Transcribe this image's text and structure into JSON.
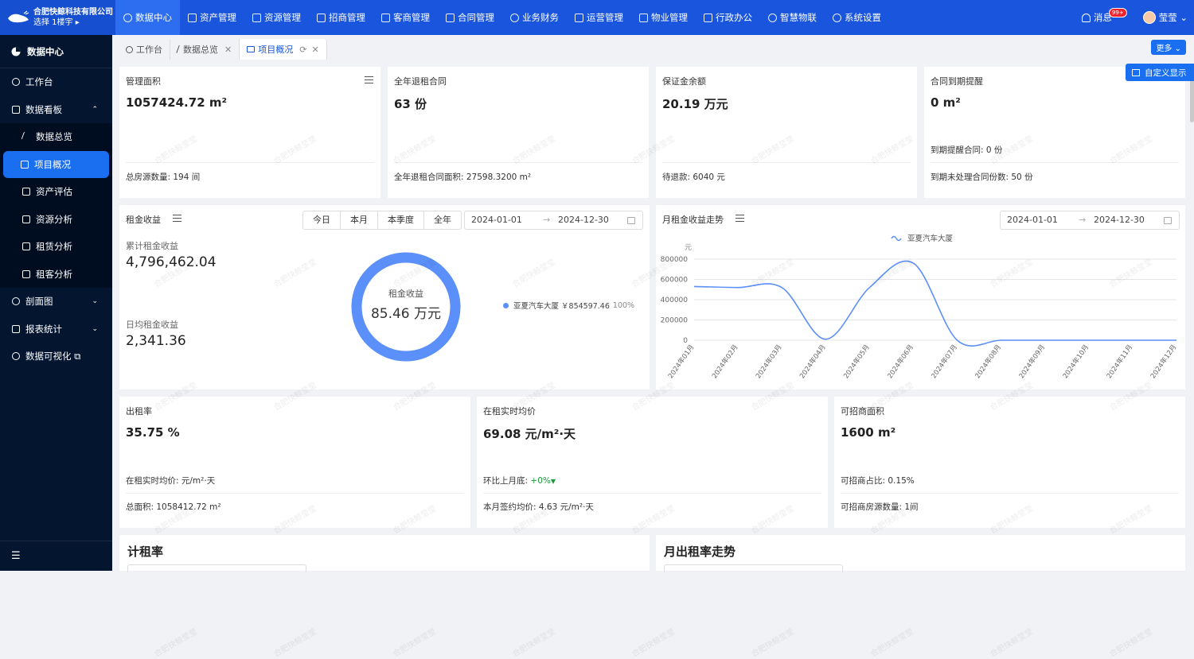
{
  "header": {
    "company": "合肥快鲸科技有限公司",
    "building_select": "选择 1楼宇 ▸",
    "nav": [
      {
        "label": "数据中心",
        "active": true
      },
      {
        "label": "资产管理"
      },
      {
        "label": "资源管理"
      },
      {
        "label": "招商管理"
      },
      {
        "label": "客商管理"
      },
      {
        "label": "合同管理"
      },
      {
        "label": "业务财务"
      },
      {
        "label": "运营管理"
      },
      {
        "label": "物业管理"
      },
      {
        "label": "行政办公"
      },
      {
        "label": "智慧物联"
      },
      {
        "label": "系统设置"
      }
    ],
    "message_label": "消息",
    "message_badge": "99+",
    "user": "莹莹 ⌄"
  },
  "sidebar": {
    "title": "数据中心",
    "items": [
      {
        "label": "工作台"
      },
      {
        "label": "数据看板",
        "arrow": "⌃"
      },
      {
        "label": "数据总览"
      },
      {
        "label": "项目概况"
      },
      {
        "label": "资产评估"
      },
      {
        "label": "资源分析"
      },
      {
        "label": "租赁分析"
      },
      {
        "label": "租客分析"
      },
      {
        "label": "剖面图",
        "arrow": "⌄"
      },
      {
        "label": "报表统计",
        "arrow": "⌄"
      },
      {
        "label": "数据可视化 ⧉"
      }
    ],
    "collapse": "☰"
  },
  "tabs": [
    {
      "label": "工作台"
    },
    {
      "label": "数据总览",
      "close": "✕"
    },
    {
      "label": "项目概况",
      "close": "✕"
    }
  ],
  "more_button": "更多 ⌄",
  "custom_button": "自定义显示",
  "watermark": "合肥快鲸莹莹",
  "cards_row1": [
    {
      "title": "管理面积",
      "value": "1057424.72 m²",
      "lines": [
        "总房源数量: 194 间"
      ]
    },
    {
      "title": "全年退租合同",
      "value": "63 份",
      "lines": [
        "全年退租合同面积: 27598.3200 m²"
      ]
    },
    {
      "title": "保证金余额",
      "value": "20.19 万元",
      "lines": [
        "待退款: 6040 元"
      ]
    },
    {
      "title": "合同到期提醒",
      "value": "0 m²",
      "lines": [
        "到期提醒合同: 0 份",
        "到期未处理合同份数: 50 份"
      ]
    }
  ],
  "rent_income": {
    "title": "租金收益",
    "segments": [
      "今日",
      "本月",
      "本季度",
      "全年"
    ],
    "date_start": "2024-01-01",
    "date_end": "2024-12-30",
    "cum_label": "累计租金收益",
    "cum_value": "4,796,462.04",
    "daily_label": "日均租金收益",
    "daily_value": "2,341.36",
    "donut_label": "租金收益",
    "donut_value": "85.46 万元",
    "legend": "亚夏汽车大厦 ￥854597.46",
    "legend_pct": "100%",
    "color": "#5b8ff9"
  },
  "trend": {
    "title": "月租金收益走势",
    "date_start": "2024-01-01",
    "date_end": "2024-12-30"
  },
  "chart_data": {
    "type": "line",
    "x": [
      "2024年01月",
      "2024年02月",
      "2024年03月",
      "2024年04月",
      "2024年05月",
      "2024年06月",
      "2024年07月",
      "2024年08月",
      "2024年09月",
      "2024年10月",
      "2024年11月",
      "2024年12月"
    ],
    "series": [
      {
        "name": "亚夏汽车大厦",
        "values": [
          530000,
          520000,
          520000,
          10000,
          520000,
          760000,
          0,
          0,
          0,
          0,
          0,
          0
        ]
      }
    ],
    "ylabel": "元",
    "yticks": [
      "800000",
      "600000",
      "400000",
      "200000",
      "0"
    ],
    "ylim": [
      0,
      800000
    ],
    "color": "#5b8ff9",
    "legend": "top"
  },
  "cards_row2": [
    {
      "title": "出租率",
      "value": "35.75 %",
      "lines": [
        "在租实时均价: 元/m²·天",
        "总面积: 1058412.72 m²"
      ]
    },
    {
      "title": "在租实时均价",
      "value": "69.08 元/m²·天",
      "lines": [
        "环比上月底: ",
        "本月签约均价: 4.63 元/m²·天"
      ],
      "delta": "+0%"
    },
    {
      "title": "可招商面积",
      "value": "1600 m²",
      "lines": [
        "可招商占比: 0.15%",
        "可招商房源数量: 1间"
      ]
    }
  ],
  "section_titles": [
    "计租率",
    "月出租率走势"
  ]
}
